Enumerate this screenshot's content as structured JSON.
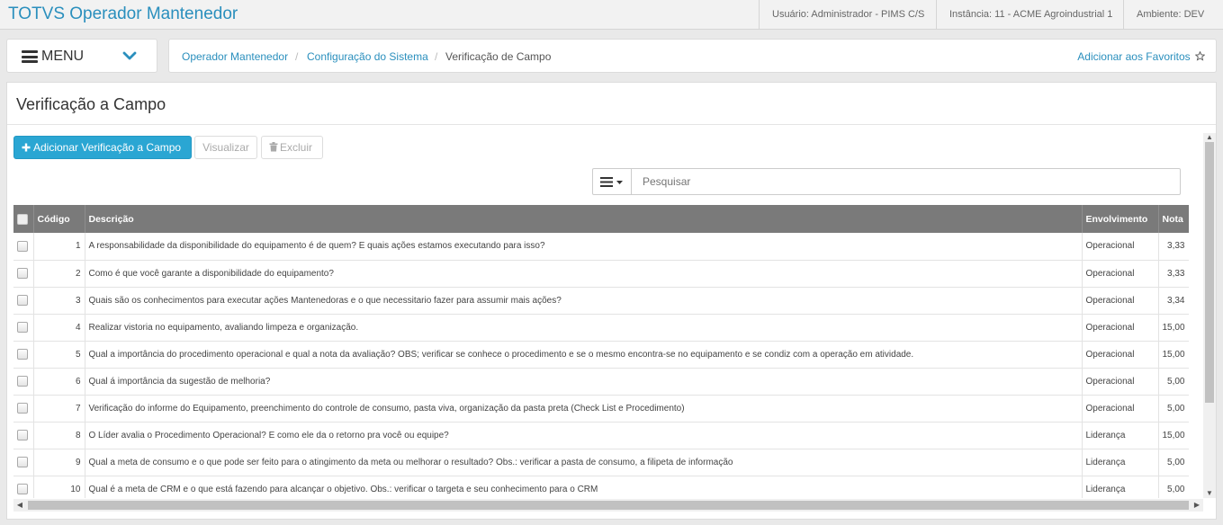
{
  "app": {
    "title": "TOTVS Operador Mantenedor"
  },
  "header": {
    "user": "Usuário: Administrador - PIMS C/S",
    "instance": "Instância: 11 - ACME Agroindustrial 1",
    "environment": "Ambiente: DEV"
  },
  "menu": {
    "label": "MENU"
  },
  "breadcrumb": {
    "items": [
      "Operador Mantenedor",
      "Configuração do Sistema",
      "Verificação de Campo"
    ],
    "separator": "/",
    "favorites": "Adicionar aos Favoritos"
  },
  "page": {
    "title": "Verificação a Campo"
  },
  "toolbar": {
    "add_label": "Adicionar Verificação a Campo",
    "view_label": "Visualizar",
    "delete_label": "Excluir"
  },
  "search": {
    "placeholder": "Pesquisar"
  },
  "table": {
    "columns": {
      "code": "Código",
      "description": "Descrição",
      "involvement": "Envolvimento",
      "grade": "Nota"
    },
    "rows": [
      {
        "code": "1",
        "description": "A responsabilidade da disponibilidade do equipamento é de quem? E quais ações estamos executando para isso?",
        "involvement": "Operacional",
        "grade": "3,33"
      },
      {
        "code": "2",
        "description": "Como é que você garante a disponibilidade do equipamento?",
        "involvement": "Operacional",
        "grade": "3,33"
      },
      {
        "code": "3",
        "description": "Quais são os conhecimentos para executar ações Mantenedoras e o que necessitario fazer para assumir mais ações?",
        "involvement": "Operacional",
        "grade": "3,34"
      },
      {
        "code": "4",
        "description": "Realizar vistoria no equipamento, avaliando limpeza e organização.",
        "involvement": "Operacional",
        "grade": "15,00"
      },
      {
        "code": "5",
        "description": "Qual a importância do procedimento operacional e qual a nota da avaliação? OBS; verificar se conhece o procedimento e se o mesmo encontra-se no equipamento e se condiz com a operação em atividade.",
        "involvement": "Operacional",
        "grade": "15,00"
      },
      {
        "code": "6",
        "description": "Qual á importância da sugestão de melhoria?",
        "involvement": "Operacional",
        "grade": "5,00"
      },
      {
        "code": "7",
        "description": "Verificação do informe do Equipamento, preenchimento do controle de consumo, pasta viva, organização da pasta preta (Check List e Procedimento)",
        "involvement": "Operacional",
        "grade": "5,00"
      },
      {
        "code": "8",
        "description": "O Líder avalia o Procedimento Operacional? E como ele da o retorno pra você ou equipe?",
        "involvement": "Liderança",
        "grade": "15,00"
      },
      {
        "code": "9",
        "description": "Qual a meta de consumo e o que pode ser feito para o atingimento da meta ou melhorar o resultado? Obs.: verificar a pasta de consumo, a filipeta de informação",
        "involvement": "Liderança",
        "grade": "5,00"
      },
      {
        "code": "10",
        "description": "Qual é a meta de CRM e o que está fazendo para alcançar o objetivo. Obs.: verificar o targeta e seu conhecimento para o CRM",
        "involvement": "Liderança",
        "grade": "5,00"
      }
    ]
  },
  "icons": {
    "hamburger": "hamburger-icon",
    "chevron": "chevron-down-icon",
    "star": "star-icon",
    "plus": "plus-icon",
    "trash": "trash-icon",
    "list_toggle": "list-icon"
  },
  "colors": {
    "accent": "#2a8fbd",
    "primary_button": "#2aa6d3",
    "table_header": "#7a7a7a"
  }
}
